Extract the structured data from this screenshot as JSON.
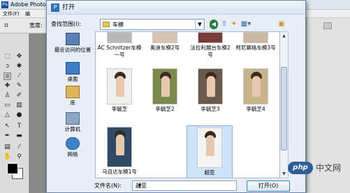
{
  "photoshop": {
    "app_title": "Adobe Photos",
    "logo_text": "Ps",
    "menu": [
      "文件(F)",
      "编"
    ],
    "options_label": "宽度:"
  },
  "dialog": {
    "title": "打开",
    "look_in_label": "查找范围(I):",
    "look_in_value": "车模",
    "places": [
      {
        "label": "最近访问的位置"
      },
      {
        "label": "桌面"
      },
      {
        "label": "库"
      },
      {
        "label": "计算机"
      },
      {
        "label": "网络"
      }
    ],
    "top_row_files": [
      "AC Schnitzer车模一号",
      "奥迪车模2号",
      "法拉利展台车模2号",
      "柯尼赛格车模3号"
    ],
    "files": [
      "李毓芝",
      "李毓芝2",
      "李毓芝3",
      "李毓芝4",
      "马自达车模1号",
      "超亚"
    ],
    "selected_file": "超亚",
    "file_name_label": "文件名(N):",
    "file_name_value": "超亚",
    "open_button": "打开(O)"
  },
  "watermark": {
    "logo": "php",
    "text": "中文网"
  }
}
